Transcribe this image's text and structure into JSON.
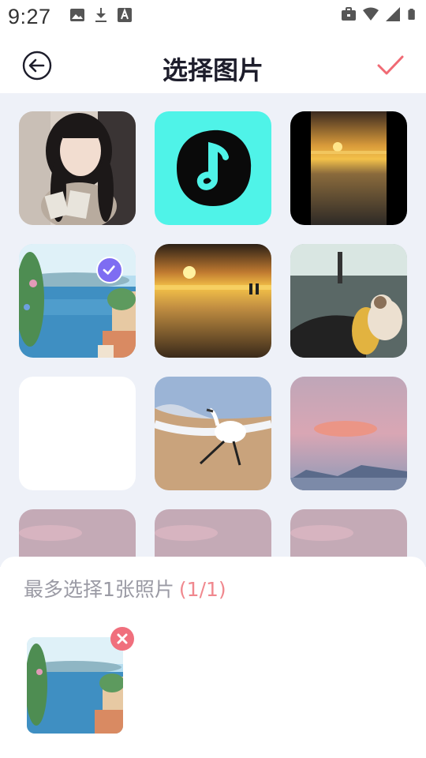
{
  "status_bar": {
    "time": "9:27",
    "left_icons": [
      "gallery-icon",
      "download-icon",
      "text-a-icon"
    ],
    "right_icons": [
      "briefcase-icon",
      "wifi-icon",
      "signal-icon",
      "battery-icon"
    ]
  },
  "header": {
    "title": "选择图片",
    "back_icon": "back-arrow-icon",
    "confirm_icon": "checkmark-icon",
    "accent_color": "#f06a74"
  },
  "grid": {
    "background": "#eef1f8",
    "items": [
      {
        "name": "photo-girl",
        "selected": false
      },
      {
        "name": "music-note-app",
        "selected": false
      },
      {
        "name": "photo-sunset-narrow",
        "selected": false
      },
      {
        "name": "photo-coastal-town",
        "selected": true
      },
      {
        "name": "photo-sunset-beach",
        "selected": false
      },
      {
        "name": "photo-cat-driving",
        "selected": false
      },
      {
        "name": "photo-blank",
        "selected": false
      },
      {
        "name": "photo-egret",
        "selected": false
      },
      {
        "name": "photo-pink-sky",
        "selected": false
      },
      {
        "name": "photo-pink-sky",
        "selected": false
      },
      {
        "name": "photo-pink-sky",
        "selected": false
      },
      {
        "name": "photo-pink-sky",
        "selected": false
      }
    ],
    "check_color": "#7e6df2"
  },
  "bottom": {
    "limit_text": "最多选择1张照片",
    "limit_count": "(1/1)",
    "selected_thumb": "photo-coastal-town",
    "remove_icon": "close-icon"
  }
}
